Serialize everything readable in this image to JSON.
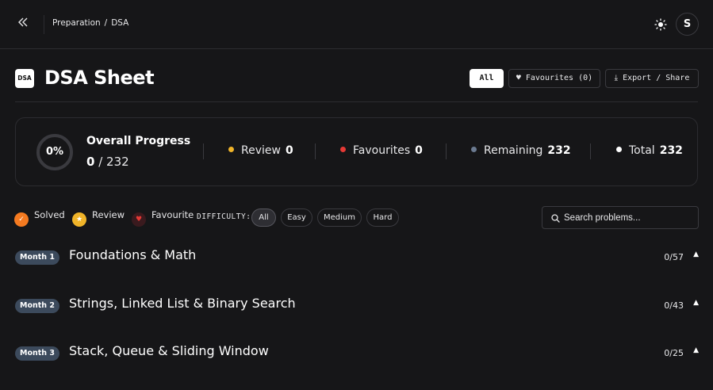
{
  "header": {
    "breadcrumb": [
      "Preparation",
      "DSA"
    ],
    "breadcrumb_sep": "/",
    "avatar_initial": "S",
    "icons": {
      "back": "double-chevron-left-icon",
      "theme": "sun-icon"
    }
  },
  "page": {
    "logo_text": "DSA",
    "title": "DSA Sheet",
    "filters": {
      "all": "All",
      "favourites": "♥ Favourites (0)",
      "export": "⤓ Export / Share"
    }
  },
  "progress": {
    "percent": "0%",
    "percent_value": 0,
    "title": "Overall Progress",
    "solved": "0",
    "total_label": "/ 232",
    "stats": [
      {
        "label": "Review",
        "value": "0",
        "color": "#f0b429"
      },
      {
        "label": "Favourites",
        "value": "0",
        "color": "#e53935"
      },
      {
        "label": "Remaining",
        "value": "232",
        "color": "#6b7a90"
      },
      {
        "label": "Total",
        "value": "232",
        "color": "#ffffff"
      }
    ]
  },
  "legend": {
    "solved": "Solved",
    "review": "Review",
    "favourite": "Favourite",
    "colors": {
      "solved": "#f47a20",
      "review": "#f0b429",
      "favourite": "#3a1a1e"
    }
  },
  "difficulty": {
    "label": "DIFFICULTY:",
    "options": [
      "All",
      "Easy",
      "Medium",
      "Hard"
    ],
    "selected": "All"
  },
  "search": {
    "placeholder": "Search problems..."
  },
  "months": [
    {
      "badge": "Month 1",
      "title": "Foundations & Math",
      "count": "0/57"
    },
    {
      "badge": "Month 2",
      "title": "Strings, Linked List & Binary Search",
      "count": "0/43"
    },
    {
      "badge": "Month 3",
      "title": "Stack, Queue & Sliding Window",
      "count": "0/25"
    }
  ]
}
